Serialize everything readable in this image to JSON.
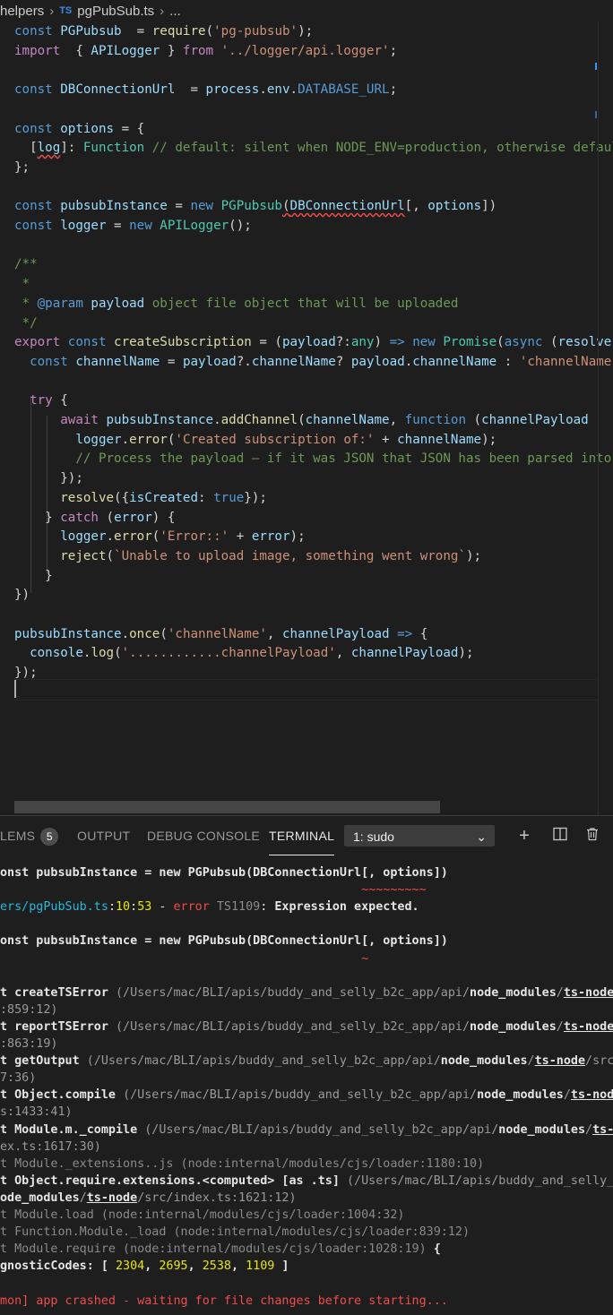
{
  "breadcrumb": {
    "part1": "helpers",
    "lang_badge": "TS",
    "file": "pgPubSub.ts",
    "tail": "..."
  },
  "code": [
    {
      "segments": [
        [
          "k",
          "const "
        ],
        [
          "v",
          "PGPubsub"
        ],
        [
          "",
          "  = "
        ],
        [
          "f",
          "require"
        ],
        [
          "",
          "("
        ],
        [
          "s",
          "'pg-pubsub'"
        ],
        [
          "",
          ");"
        ]
      ]
    },
    {
      "segments": [
        [
          "c2",
          "import"
        ],
        [
          "",
          "  { "
        ],
        [
          "v",
          "APILogger"
        ],
        [
          "",
          " } "
        ],
        [
          "c2",
          "from"
        ],
        [
          "s",
          " '../logger/api.logger'"
        ],
        [
          "",
          ";"
        ]
      ]
    },
    {
      "segments": []
    },
    {
      "segments": [
        [
          "k",
          "const "
        ],
        [
          "v",
          "DBConnectionUrl"
        ],
        [
          "",
          "  = "
        ],
        [
          "v",
          "process"
        ],
        [
          "",
          "."
        ],
        [
          "v",
          "env"
        ],
        [
          "",
          "."
        ],
        [
          "bc",
          "DATABASE_URL"
        ],
        [
          "",
          ";"
        ]
      ]
    },
    {
      "segments": []
    },
    {
      "segments": [
        [
          "k",
          "const "
        ],
        [
          "v",
          "options"
        ],
        [
          "",
          " = {"
        ]
      ]
    },
    {
      "segments": [
        [
          "",
          "  ["
        ],
        [
          "v",
          "log"
        ],
        [
          "",
          "]: "
        ],
        [
          "t",
          "Function"
        ],
        [
          "cm",
          " // default: silent when NODE_ENV=production, otherwise defaults"
        ]
      ]
    },
    {
      "segments": [
        [
          "",
          "};"
        ]
      ]
    },
    {
      "segments": []
    },
    {
      "segments": [
        [
          "k",
          "const "
        ],
        [
          "v",
          "pubsubInstance"
        ],
        [
          "",
          " = "
        ],
        [
          "k",
          "new "
        ],
        [
          "t",
          "PGPubsub"
        ],
        [
          "",
          "("
        ],
        [
          "v",
          "DBConnectionUrl"
        ],
        [
          "",
          "[, "
        ],
        [
          "v",
          "options"
        ],
        [
          "",
          "])"
        ]
      ]
    },
    {
      "segments": [
        [
          "k",
          "const "
        ],
        [
          "v",
          "logger"
        ],
        [
          "",
          " = "
        ],
        [
          "k",
          "new "
        ],
        [
          "t",
          "APILogger"
        ],
        [
          "",
          "();"
        ]
      ]
    },
    {
      "segments": []
    },
    {
      "segments": [
        [
          "cm",
          "/**"
        ]
      ]
    },
    {
      "segments": [
        [
          "cm",
          " *"
        ]
      ]
    },
    {
      "segments": [
        [
          "cm",
          " * "
        ],
        [
          "k",
          "@param "
        ],
        [
          "v",
          "payload"
        ],
        [
          "cm",
          " object file object that will be uploaded"
        ]
      ]
    },
    {
      "segments": [
        [
          "cm",
          " */"
        ]
      ]
    },
    {
      "segments": [
        [
          "c2",
          "export "
        ],
        [
          "k",
          "const "
        ],
        [
          "f",
          "createSubscription"
        ],
        [
          "",
          " = ("
        ],
        [
          "v",
          "payload"
        ],
        [
          "",
          "?:"
        ],
        [
          "t",
          "any"
        ],
        [
          "",
          ") "
        ],
        [
          "k",
          "=> "
        ],
        [
          "k",
          "new "
        ],
        [
          "t",
          "Promise"
        ],
        [
          "",
          "("
        ],
        [
          "k",
          "async"
        ],
        [
          "",
          " ("
        ],
        [
          "v",
          "resolve"
        ]
      ]
    },
    {
      "segments": [
        [
          "",
          "  "
        ],
        [
          "k",
          "const "
        ],
        [
          "v",
          "channelName"
        ],
        [
          "",
          " = "
        ],
        [
          "v",
          "payload"
        ],
        [
          "",
          "?."
        ],
        [
          "v",
          "channelName"
        ],
        [
          "",
          "? "
        ],
        [
          "v",
          "payload"
        ],
        [
          "",
          "."
        ],
        [
          "v",
          "channelName"
        ],
        [
          "",
          " : "
        ],
        [
          "s",
          "'channelName'"
        ]
      ]
    },
    {
      "segments": []
    },
    {
      "segments": [
        [
          "",
          "  "
        ],
        [
          "c2",
          "try"
        ],
        [
          "",
          " {"
        ]
      ]
    },
    {
      "segments": [
        [
          "",
          "      "
        ],
        [
          "c2",
          "await "
        ],
        [
          "v",
          "pubsubInstance"
        ],
        [
          "",
          "."
        ],
        [
          "f",
          "addChannel"
        ],
        [
          "",
          "("
        ],
        [
          "v",
          "channelName"
        ],
        [
          "",
          ", "
        ],
        [
          "k",
          "function"
        ],
        [
          "",
          " ("
        ],
        [
          "v",
          "channelPayload"
        ]
      ]
    },
    {
      "segments": [
        [
          "",
          "        "
        ],
        [
          "v",
          "logger"
        ],
        [
          "",
          "."
        ],
        [
          "f",
          "error"
        ],
        [
          "",
          "("
        ],
        [
          "s",
          "'Created subscription of:'"
        ],
        [
          "",
          " + "
        ],
        [
          "v",
          "channelName"
        ],
        [
          "",
          ");"
        ]
      ]
    },
    {
      "segments": [
        [
          "",
          "        "
        ],
        [
          "cm",
          "// Process the payload – if it was JSON that JSON has been parsed into"
        ]
      ]
    },
    {
      "segments": [
        [
          "",
          "      });"
        ]
      ]
    },
    {
      "segments": [
        [
          "",
          "      "
        ],
        [
          "f",
          "resolve"
        ],
        [
          "",
          "({"
        ],
        [
          "v",
          "isCreated"
        ],
        [
          "",
          ": "
        ],
        [
          "k",
          "true"
        ],
        [
          "",
          "});"
        ]
      ]
    },
    {
      "segments": [
        [
          "",
          "    } "
        ],
        [
          "c2",
          "catch"
        ],
        [
          "",
          " ("
        ],
        [
          "v",
          "error"
        ],
        [
          "",
          ") {"
        ]
      ]
    },
    {
      "segments": [
        [
          "",
          "      "
        ],
        [
          "v",
          "logger"
        ],
        [
          "",
          "."
        ],
        [
          "f",
          "error"
        ],
        [
          "",
          "("
        ],
        [
          "s",
          "'Error::'"
        ],
        [
          "",
          " + "
        ],
        [
          "v",
          "error"
        ],
        [
          "",
          ");"
        ]
      ]
    },
    {
      "segments": [
        [
          "",
          "      "
        ],
        [
          "f",
          "reject"
        ],
        [
          "",
          "("
        ],
        [
          "s",
          "`Unable to upload image, something went wrong`"
        ],
        [
          "",
          ");"
        ]
      ]
    },
    {
      "segments": [
        [
          "",
          "    }"
        ]
      ]
    },
    {
      "segments": [
        [
          "",
          "})"
        ]
      ]
    },
    {
      "segments": []
    },
    {
      "segments": [
        [
          "v",
          "pubsubInstance"
        ],
        [
          "",
          "."
        ],
        [
          "f",
          "once"
        ],
        [
          "",
          "("
        ],
        [
          "s",
          "'channelName'"
        ],
        [
          "",
          ", "
        ],
        [
          "v",
          "channelPayload"
        ],
        [
          "",
          " "
        ],
        [
          "k",
          "=>"
        ],
        [
          "",
          " {"
        ]
      ]
    },
    {
      "segments": [
        [
          "",
          "  "
        ],
        [
          "v",
          "console"
        ],
        [
          "",
          "."
        ],
        [
          "f",
          "log"
        ],
        [
          "",
          "("
        ],
        [
          "s",
          "'............channelPayload'"
        ],
        [
          "",
          ", "
        ],
        [
          "v",
          "channelPayload"
        ],
        [
          "",
          ");"
        ]
      ]
    },
    {
      "segments": [
        [
          "",
          "});"
        ]
      ]
    },
    {
      "segments": []
    }
  ],
  "panel": {
    "tabs": [
      {
        "label": "LEMS",
        "badge": "5"
      },
      {
        "label": "OUTPUT"
      },
      {
        "label": "DEBUG CONSOLE"
      },
      {
        "label": "TERMINAL",
        "active": true
      }
    ],
    "terminal_select": "1: sudo",
    "icons": [
      "plus-icon",
      "split-icon",
      "trash-icon"
    ]
  },
  "terminal": [
    {
      "segments": [
        [
          "tb",
          "onst pubsubInstance = new PGPubsub(DBConnectionUrl[, options])"
        ]
      ]
    },
    {
      "segments": [
        [
          "tred",
          "                                                  ~~~~~~~~~"
        ]
      ]
    },
    {
      "segments": [
        [
          "tcyan",
          "ers/pgPubSub.ts"
        ],
        [
          "",
          ":"
        ],
        [
          "tyel",
          "10"
        ],
        [
          "",
          ":"
        ],
        [
          "tyel",
          "53"
        ],
        [
          "",
          " - "
        ],
        [
          "tred",
          "error"
        ],
        [
          "tgray",
          " TS1109"
        ],
        [
          "",
          ": "
        ],
        [
          "tb",
          "Expression expected."
        ]
      ]
    },
    {
      "segments": []
    },
    {
      "segments": [
        [
          "tb",
          "onst pubsubInstance = new PGPubsub(DBConnectionUrl[, options])"
        ]
      ]
    },
    {
      "segments": [
        [
          "tred",
          "                                                  ~"
        ]
      ]
    },
    {
      "segments": []
    },
    {
      "segments": [
        [
          "tb",
          "t createTSError "
        ],
        [
          "tdim",
          "(/Users/mac/BLI/apis/buddy_and_selly_b2c_app/api/"
        ],
        [
          "tb",
          "node_modules"
        ],
        [
          "tdim",
          "/"
        ],
        [
          "tb tu",
          "ts-node"
        ],
        [
          "tdim",
          "/"
        ]
      ]
    },
    {
      "segments": [
        [
          "tdim",
          ":859:12)"
        ]
      ]
    },
    {
      "segments": [
        [
          "tb",
          "t reportTSError "
        ],
        [
          "tdim",
          "(/Users/mac/BLI/apis/buddy_and_selly_b2c_app/api/"
        ],
        [
          "tb",
          "node_modules"
        ],
        [
          "tdim",
          "/"
        ],
        [
          "tb tu",
          "ts-node"
        ],
        [
          "tdim",
          "/"
        ]
      ]
    },
    {
      "segments": [
        [
          "tdim",
          ":863:19)"
        ]
      ]
    },
    {
      "segments": [
        [
          "tb",
          "t getOutput "
        ],
        [
          "tdim",
          "(/Users/mac/BLI/apis/buddy_and_selly_b2c_app/api/"
        ],
        [
          "tb",
          "node_modules"
        ],
        [
          "tdim",
          "/"
        ],
        [
          "tb tu",
          "ts-node"
        ],
        [
          "tdim",
          "/src/"
        ]
      ]
    },
    {
      "segments": [
        [
          "tdim",
          "7:36)"
        ]
      ]
    },
    {
      "segments": [
        [
          "tb",
          "t Object.compile "
        ],
        [
          "tdim",
          "(/Users/mac/BLI/apis/buddy_and_selly_b2c_app/api/"
        ],
        [
          "tb",
          "node_modules"
        ],
        [
          "tdim",
          "/"
        ],
        [
          "tb tu",
          "ts-node"
        ]
      ]
    },
    {
      "segments": [
        [
          "tdim",
          "s:1433:41)"
        ]
      ]
    },
    {
      "segments": [
        [
          "tb",
          "t Module.m._compile "
        ],
        [
          "tdim",
          "(/Users/mac/BLI/apis/buddy_and_selly_b2c_app/api/"
        ],
        [
          "tb",
          "node_modules"
        ],
        [
          "tdim",
          "/"
        ],
        [
          "tb tu",
          "ts-n"
        ]
      ]
    },
    {
      "segments": [
        [
          "tdim",
          "ex.ts:1617:30)"
        ]
      ]
    },
    {
      "segments": [
        [
          "tgray",
          "t Module._extensions..js (node:internal/modules/cjs/loader:1180:10)"
        ]
      ]
    },
    {
      "segments": [
        [
          "tb",
          "t Object.require.extensions.<computed> [as .ts] "
        ],
        [
          "tdim",
          "(/Users/mac/BLI/apis/buddy_and_selly_b"
        ]
      ]
    },
    {
      "segments": [
        [
          "tb",
          "ode_modules"
        ],
        [
          "tdim",
          "/"
        ],
        [
          "tb tu",
          "ts-node"
        ],
        [
          "tdim",
          "/src/index.ts:1621:12)"
        ]
      ]
    },
    {
      "segments": [
        [
          "tgray",
          "t Module.load (node:internal/modules/cjs/loader:1004:32)"
        ]
      ]
    },
    {
      "segments": [
        [
          "tgray",
          "t Function.Module._load (node:internal/modules/cjs/loader:839:12)"
        ]
      ]
    },
    {
      "segments": [
        [
          "tgray",
          "t Module.require (node:internal/modules/cjs/loader:1028:19) "
        ],
        [
          "tb",
          "{"
        ]
      ]
    },
    {
      "segments": [
        [
          "tb",
          "gnosticCodes: [ "
        ],
        [
          "tyel",
          "2304"
        ],
        [
          "tb",
          ", "
        ],
        [
          "tyel",
          "2695"
        ],
        [
          "tb",
          ", "
        ],
        [
          "tyel",
          "2538"
        ],
        [
          "tb",
          ", "
        ],
        [
          "tyel",
          "1109"
        ],
        [
          "tb",
          " ]"
        ]
      ]
    },
    {
      "segments": []
    },
    {
      "segments": [
        [
          "tred",
          "mon] app crashed - waiting for file changes before starting..."
        ]
      ]
    }
  ]
}
